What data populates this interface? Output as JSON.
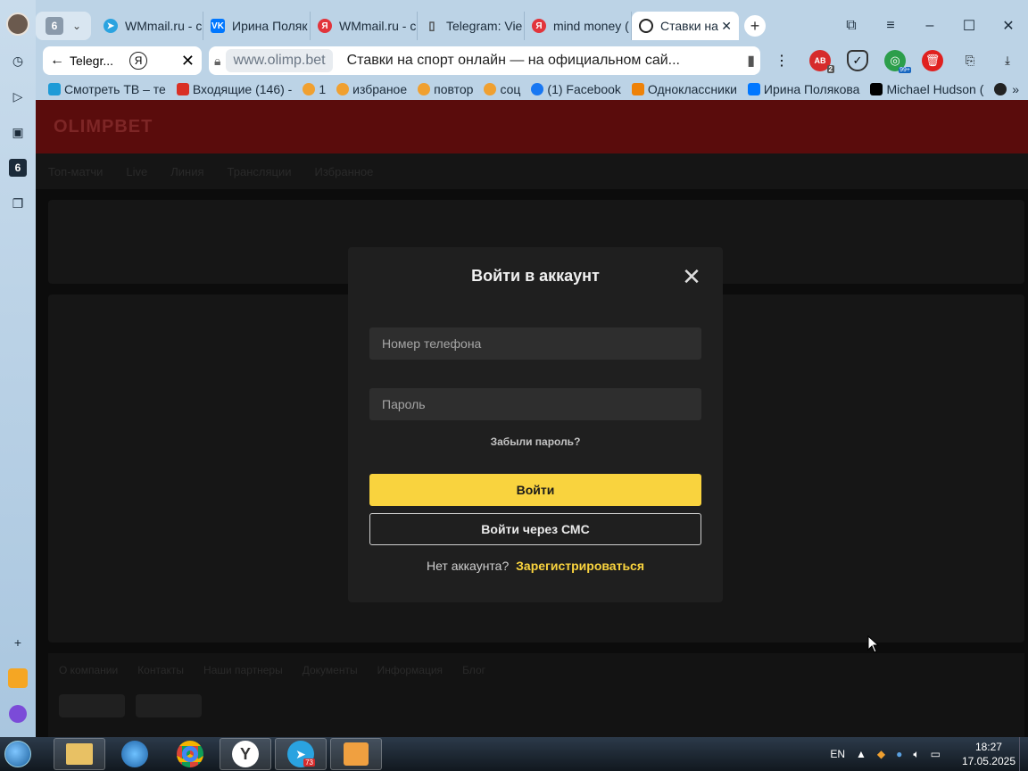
{
  "browser": {
    "sidebar": {
      "tab_count": "6"
    },
    "tab_group_count": "6",
    "tabs": [
      {
        "label": "WMmail.ru - с",
        "icon": "telegram-icon",
        "color": "#2aa3e0"
      },
      {
        "label": "Ирина Поляк",
        "icon": "vk-icon",
        "color": "#0077ff"
      },
      {
        "label": "WMmail.ru - с",
        "icon": "yandex-icon",
        "color": "#e2343b"
      },
      {
        "label": "Telegram: Vie",
        "icon": "document-icon",
        "color": "#444444"
      },
      {
        "label": "mind money (",
        "icon": "yandex-icon",
        "color": "#e2343b"
      },
      {
        "label": "Ставки на",
        "icon": "loading-icon",
        "color": "#222222",
        "active": true
      }
    ],
    "back_tab_label": "Telegr...",
    "url_domain": "www.olimp.bet",
    "page_title": "Ставки на спорт онлайн — на официальном сай...",
    "extensions": [
      {
        "name": "adblock-icon",
        "badge": "2"
      },
      {
        "name": "shield-check-icon"
      },
      {
        "name": "globe-icon",
        "badge": "99+"
      },
      {
        "name": "trash-icon"
      },
      {
        "name": "collections-icon"
      },
      {
        "name": "download-icon"
      }
    ],
    "bookmarks": [
      {
        "label": "Смотреть ТВ – те",
        "color": "#1e9bd7"
      },
      {
        "label": "Входящие (146) -",
        "color": "#d93025"
      },
      {
        "label": "1",
        "color": "#f0a030"
      },
      {
        "label": "избраное",
        "color": "#f0a030"
      },
      {
        "label": "повтор",
        "color": "#f0a030"
      },
      {
        "label": "соц",
        "color": "#f0a030"
      },
      {
        "label": "(1) Facebook",
        "color": "#1877f2"
      },
      {
        "label": "Одноклассники",
        "color": "#ee8208"
      },
      {
        "label": "Ирина Полякова",
        "color": "#0077ff"
      },
      {
        "label": "Michael Hudson (",
        "color": "#000000"
      }
    ]
  },
  "site": {
    "logo": "OLIMPBET",
    "nav": [
      "Топ-матчи",
      "Live",
      "Линия",
      "Трансляции",
      "Избранное"
    ],
    "footer_links": [
      "О компании",
      "Контакты",
      "Наши партнеры",
      "Документы",
      "Информация",
      "Блог"
    ]
  },
  "login_modal": {
    "title": "Войти в аккаунт",
    "phone_placeholder": "Номер телефона",
    "password_placeholder": "Пароль",
    "forgot_password": "Забыли пароль?",
    "login_button": "Войти",
    "sms_button": "Войти через СМС",
    "no_account": "Нет аккаунта?",
    "register_link": "Зарегистрироваться",
    "accent_color": "#f9d33e"
  },
  "taskbar": {
    "apps": [
      {
        "name": "file-explorer-icon"
      },
      {
        "name": "internet-explorer-icon"
      },
      {
        "name": "chrome-icon"
      },
      {
        "name": "yandex-browser-icon"
      },
      {
        "name": "telegram-icon",
        "badge": "73"
      },
      {
        "name": "media-player-icon"
      }
    ],
    "language": "EN",
    "time": "18:27",
    "date": "17.05.2025"
  }
}
